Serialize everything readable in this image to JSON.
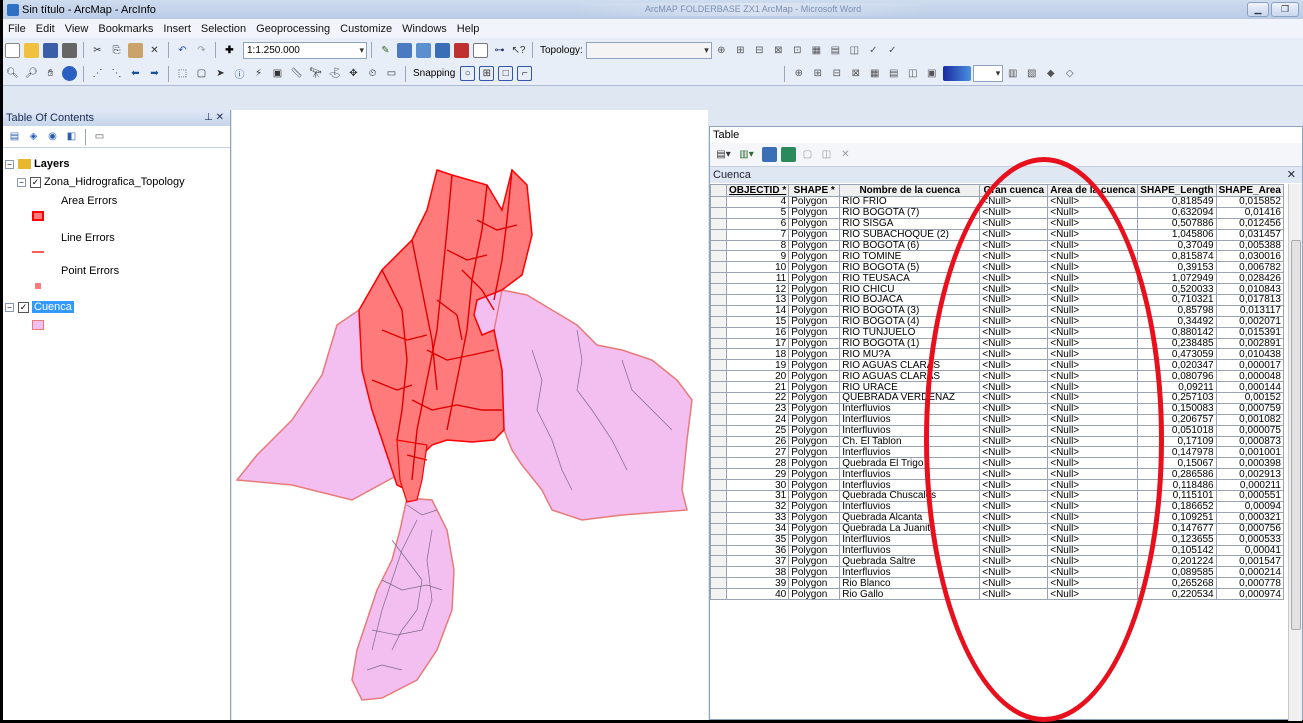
{
  "window": {
    "title": "Sin título - ArcMap - ArcInfo",
    "center_caption": "ArcMAP FOLDERBASE ZX1 ArcMap - Microsoft Word"
  },
  "menu": [
    "File",
    "Edit",
    "View",
    "Bookmarks",
    "Insert",
    "Selection",
    "Geoprocessing",
    "Customize",
    "Windows",
    "Help"
  ],
  "toolbar": {
    "scale": "1:1.250.000",
    "topology_label": "Topology:",
    "snapping_label": "Snapping"
  },
  "toc": {
    "title": "Table Of Contents",
    "layers_label": "Layers",
    "topology_layer": "Zona_Hidrografica_Topology",
    "area_errors": "Area Errors",
    "line_errors": "Line Errors",
    "point_errors": "Point Errors",
    "cuenca_layer": "Cuenca"
  },
  "colors": {
    "area_error_fill": "#ff7b7b",
    "area_error_stroke": "#ff0000",
    "cuenca_fill": "#f2bff0",
    "cuenca_stroke": "#e87a7a",
    "ellipse": "#e8101c",
    "selected_layer": "#3399ff"
  },
  "table": {
    "window_title": "Table",
    "tab_name": "Cuenca",
    "columns": [
      "OBJECTID *",
      "SHAPE *",
      "Nombre de la cuenca",
      "Gran cuenca",
      "Area de la cuenca",
      "SHAPE_Length",
      "SHAPE_Area"
    ],
    "rows": [
      [
        "4",
        "Polygon",
        "RIO FRIO",
        "<Null>",
        "<Null>",
        "0,818549",
        "0,015852"
      ],
      [
        "5",
        "Polygon",
        "RIO BOGOTA (7)",
        "<Null>",
        "<Null>",
        "0,632094",
        "0,01416"
      ],
      [
        "6",
        "Polygon",
        "RIO SISGA",
        "<Null>",
        "<Null>",
        "0,507886",
        "0,012456"
      ],
      [
        "7",
        "Polygon",
        "RIO SUBACHOQUE (2)",
        "<Null>",
        "<Null>",
        "1,045806",
        "0,031457"
      ],
      [
        "8",
        "Polygon",
        "RIO BOGOTA (6)",
        "<Null>",
        "<Null>",
        "0,37049",
        "0,005388"
      ],
      [
        "9",
        "Polygon",
        "RIO TOMINE",
        "<Null>",
        "<Null>",
        "0,815874",
        "0,030016"
      ],
      [
        "10",
        "Polygon",
        "RIO BOGOTA (5)",
        "<Null>",
        "<Null>",
        "0,39153",
        "0,006782"
      ],
      [
        "11",
        "Polygon",
        "RIO TEUSACA",
        "<Null>",
        "<Null>",
        "1,072949",
        "0,028426"
      ],
      [
        "12",
        "Polygon",
        "RIO CHICU",
        "<Null>",
        "<Null>",
        "0,520033",
        "0,010843"
      ],
      [
        "13",
        "Polygon",
        "RIO BOJACA",
        "<Null>",
        "<Null>",
        "0,710321",
        "0,017813"
      ],
      [
        "14",
        "Polygon",
        "RIO BOGOTA (3)",
        "<Null>",
        "<Null>",
        "0,85798",
        "0,013117"
      ],
      [
        "15",
        "Polygon",
        "RIO BOGOTA (4)",
        "<Null>",
        "<Null>",
        "0,34492",
        "0,002071"
      ],
      [
        "16",
        "Polygon",
        "RIO TUNJUELO",
        "<Null>",
        "<Null>",
        "0,880142",
        "0,015391"
      ],
      [
        "17",
        "Polygon",
        "RIO BOGOTA (1)",
        "<Null>",
        "<Null>",
        "0,238485",
        "0,002891"
      ],
      [
        "18",
        "Polygon",
        "RIO MU?A",
        "<Null>",
        "<Null>",
        "0,473059",
        "0,010438"
      ],
      [
        "19",
        "Polygon",
        "RIO AGUAS CLARAS",
        "<Null>",
        "<Null>",
        "0,020347",
        "0,000017"
      ],
      [
        "20",
        "Polygon",
        "RIO AGUAS CLARAS",
        "<Null>",
        "<Null>",
        "0,080796",
        "0,000048"
      ],
      [
        "21",
        "Polygon",
        "RIO URACE",
        "<Null>",
        "<Null>",
        "0,09211",
        "0,000144"
      ],
      [
        "22",
        "Polygon",
        "QUEBRADA VERDENAZ",
        "<Null>",
        "<Null>",
        "0,257103",
        "0,00152"
      ],
      [
        "23",
        "Polygon",
        "Interfluvios",
        "<Null>",
        "<Null>",
        "0,150083",
        "0,000759"
      ],
      [
        "24",
        "Polygon",
        "Interfluvios",
        "<Null>",
        "<Null>",
        "0,206757",
        "0,001082"
      ],
      [
        "25",
        "Polygon",
        "Interfluvios",
        "<Null>",
        "<Null>",
        "0,051018",
        "0,000075"
      ],
      [
        "26",
        "Polygon",
        "Ch. El Tablon",
        "<Null>",
        "<Null>",
        "0,17109",
        "0,000873"
      ],
      [
        "27",
        "Polygon",
        "Interfluvios",
        "<Null>",
        "<Null>",
        "0,147978",
        "0,001001"
      ],
      [
        "28",
        "Polygon",
        "Quebrada El Trigo",
        "<Null>",
        "<Null>",
        "0,15067",
        "0,000398"
      ],
      [
        "29",
        "Polygon",
        "Interfluvios",
        "<Null>",
        "<Null>",
        "0,286586",
        "0,002913"
      ],
      [
        "30",
        "Polygon",
        "Interfluvios",
        "<Null>",
        "<Null>",
        "0,118486",
        "0,000211"
      ],
      [
        "31",
        "Polygon",
        "Quebrada Chuscales",
        "<Null>",
        "<Null>",
        "0,115101",
        "0,000551"
      ],
      [
        "32",
        "Polygon",
        "Interfluvios",
        "<Null>",
        "<Null>",
        "0,186652",
        "0,00094"
      ],
      [
        "33",
        "Polygon",
        "Quebrada Alcanta",
        "<Null>",
        "<Null>",
        "0,109251",
        "0,000321"
      ],
      [
        "34",
        "Polygon",
        "Quebrada La Juanita",
        "<Null>",
        "<Null>",
        "0,147677",
        "0,000756"
      ],
      [
        "35",
        "Polygon",
        "Interfluvios",
        "<Null>",
        "<Null>",
        "0,123655",
        "0,000533"
      ],
      [
        "36",
        "Polygon",
        "Interfluvios",
        "<Null>",
        "<Null>",
        "0,105142",
        "0,00041"
      ],
      [
        "37",
        "Polygon",
        "Quebrada Saltre",
        "<Null>",
        "<Null>",
        "0,201224",
        "0,001547"
      ],
      [
        "38",
        "Polygon",
        "Interfluvios",
        "<Null>",
        "<Null>",
        "0,089585",
        "0,000214"
      ],
      [
        "39",
        "Polygon",
        "Rio Blanco",
        "<Null>",
        "<Null>",
        "0,265268",
        "0,000778"
      ],
      [
        "40",
        "Polygon",
        "Rio Gallo",
        "<Null>",
        "<Null>",
        "0,220534",
        "0,000974"
      ]
    ]
  }
}
